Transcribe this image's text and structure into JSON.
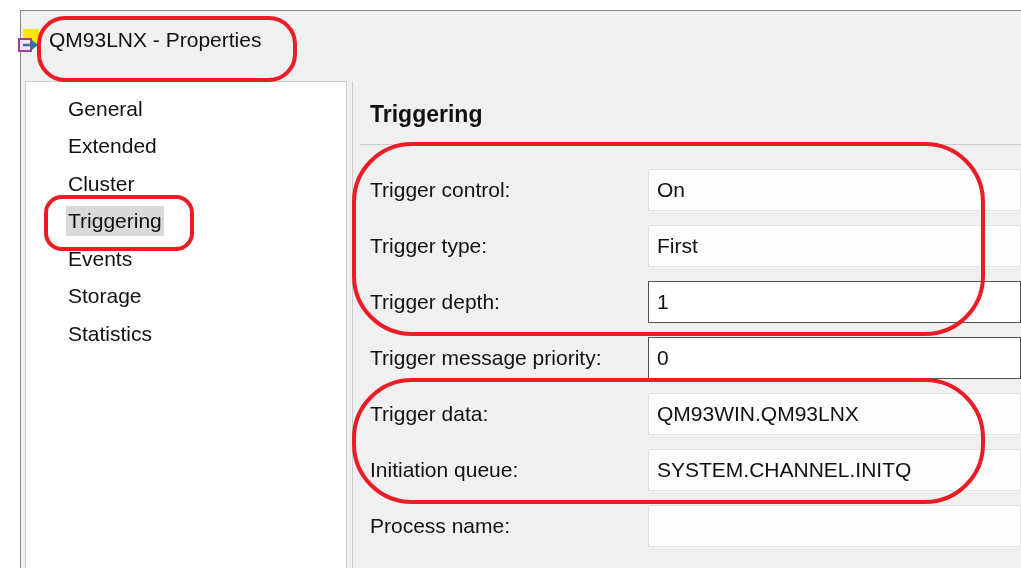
{
  "window": {
    "title": "QM93LNX - Properties",
    "circled": true
  },
  "sidebar": {
    "items": [
      {
        "label": "General",
        "selected": false,
        "circled": false
      },
      {
        "label": "Extended",
        "selected": false,
        "circled": false
      },
      {
        "label": "Cluster",
        "selected": false,
        "circled": false
      },
      {
        "label": "Triggering",
        "selected": true,
        "circled": true
      },
      {
        "label": "Events",
        "selected": false,
        "circled": false
      },
      {
        "label": "Storage",
        "selected": false,
        "circled": false
      },
      {
        "label": "Statistics",
        "selected": false,
        "circled": false
      }
    ]
  },
  "panel": {
    "heading": "Triggering",
    "field_groups": [
      {
        "circled": true,
        "fields": [
          {
            "label": "Trigger control:",
            "value": "On",
            "kind": "readonly"
          },
          {
            "label": "Trigger type:",
            "value": "First",
            "kind": "readonly"
          },
          {
            "label": "Trigger depth:",
            "value": "1",
            "kind": "editable"
          }
        ]
      },
      {
        "circled": false,
        "fields": [
          {
            "label": "Trigger message priority:",
            "value": "0",
            "kind": "editable"
          }
        ]
      },
      {
        "circled": true,
        "fields": [
          {
            "label": "Trigger data:",
            "value": "QM93WIN.QM93LNX",
            "kind": "readonly"
          },
          {
            "label": "Initiation queue:",
            "value": "SYSTEM.CHANNEL.INITQ",
            "kind": "readonly"
          }
        ]
      },
      {
        "circled": false,
        "fields": [
          {
            "label": "Process name:",
            "kind": "readonly"
          }
        ]
      }
    ]
  }
}
